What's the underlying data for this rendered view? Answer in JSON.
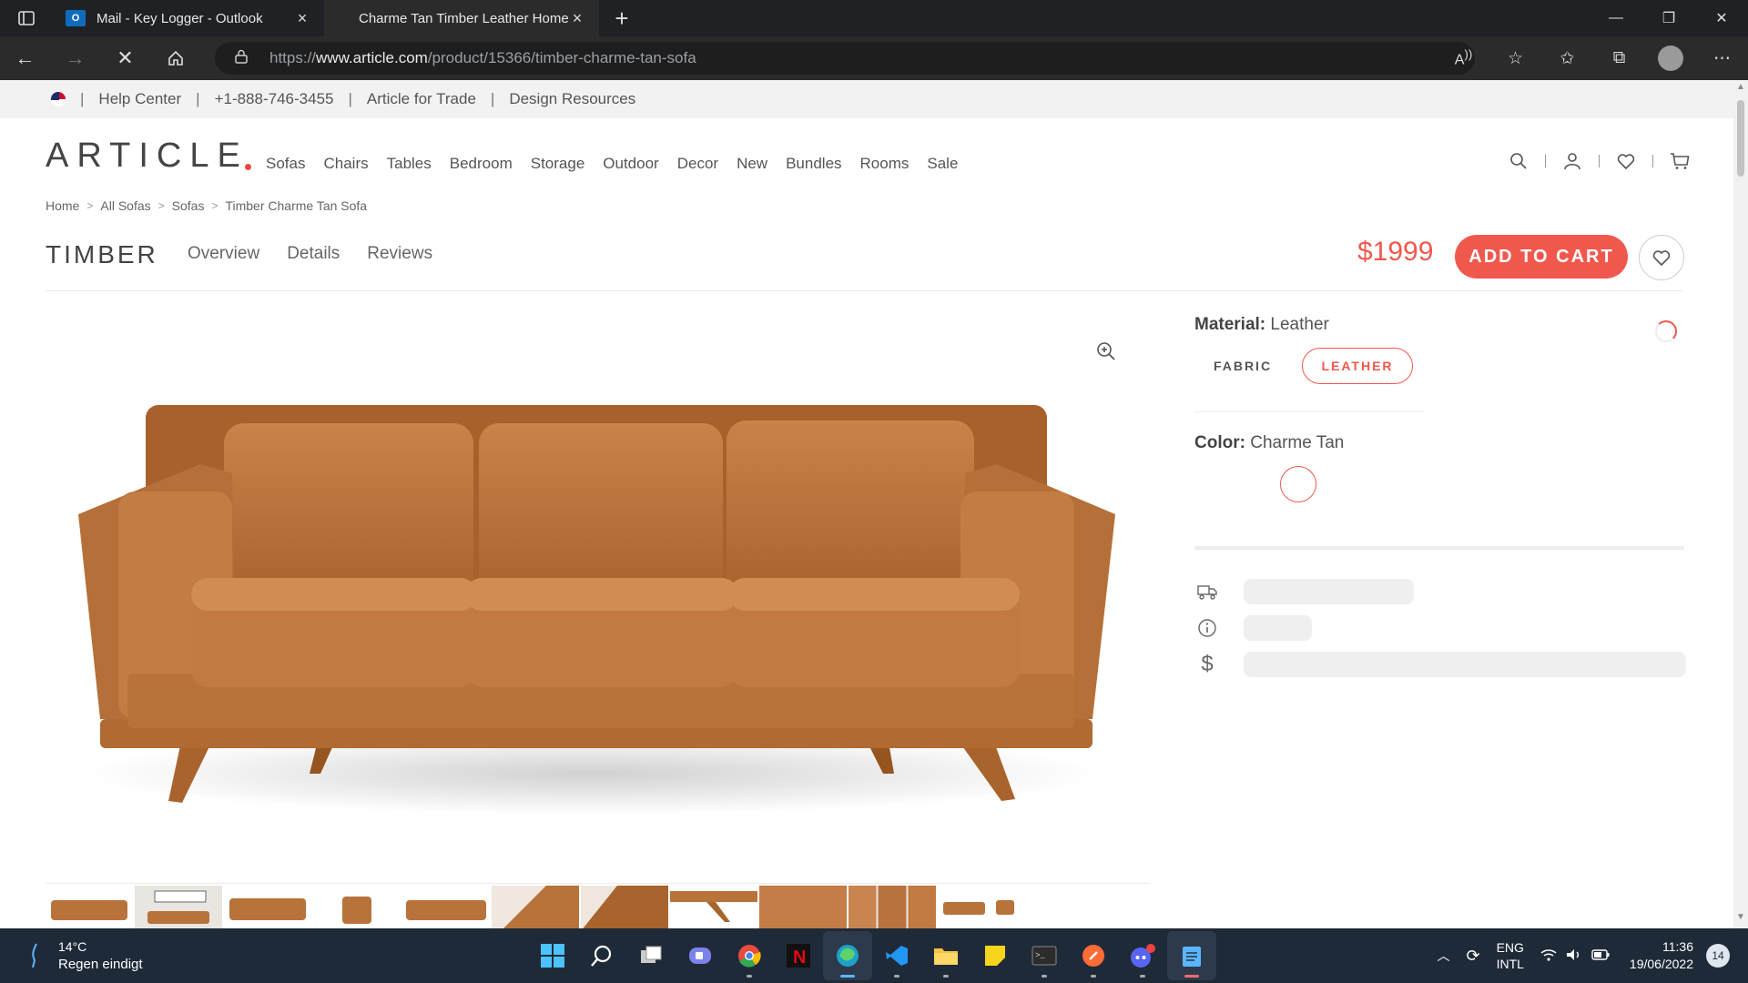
{
  "browser": {
    "tabs": [
      {
        "title": "Mail - Key Logger - Outlook",
        "active": false
      },
      {
        "title": "Charme Tan Timber Leather Home",
        "active": true
      }
    ],
    "new_tab_symbol": "+",
    "url_prefix": "https://",
    "url_host": "www.article.com",
    "url_path": "/product/15366/timber-charme-tan-sofa"
  },
  "utility_bar": {
    "items": [
      "Help Center",
      "+1-888-746-3455",
      "Article for Trade",
      "Design Resources"
    ]
  },
  "header": {
    "logo": "ARTICLE",
    "nav": [
      "Sofas",
      "Chairs",
      "Tables",
      "Bedroom",
      "Storage",
      "Outdoor",
      "Decor",
      "New",
      "Bundles",
      "Rooms",
      "Sale"
    ]
  },
  "breadcrumb": [
    "Home",
    "All Sofas",
    "Sofas",
    "Timber Charme Tan Sofa"
  ],
  "product": {
    "name": "TIMBER",
    "tabs": [
      "Overview",
      "Details",
      "Reviews"
    ],
    "price": "$1999",
    "cart_label": "ADD TO CART",
    "material_label": "Material:",
    "material_value": "Leather",
    "material_options": [
      "FABRIC",
      "LEATHER"
    ],
    "color_label": "Color:",
    "color_value": "Charme Tan",
    "swatch_color": "#b8733b"
  },
  "colors": {
    "accent": "#f0584e",
    "leather": "#b8733b"
  },
  "taskbar": {
    "temp": "14°C",
    "weather": "Regen eindigt",
    "lang_line1": "ENG",
    "lang_line2": "INTL",
    "time": "11:36",
    "date": "19/06/2022",
    "notifications": "14"
  }
}
